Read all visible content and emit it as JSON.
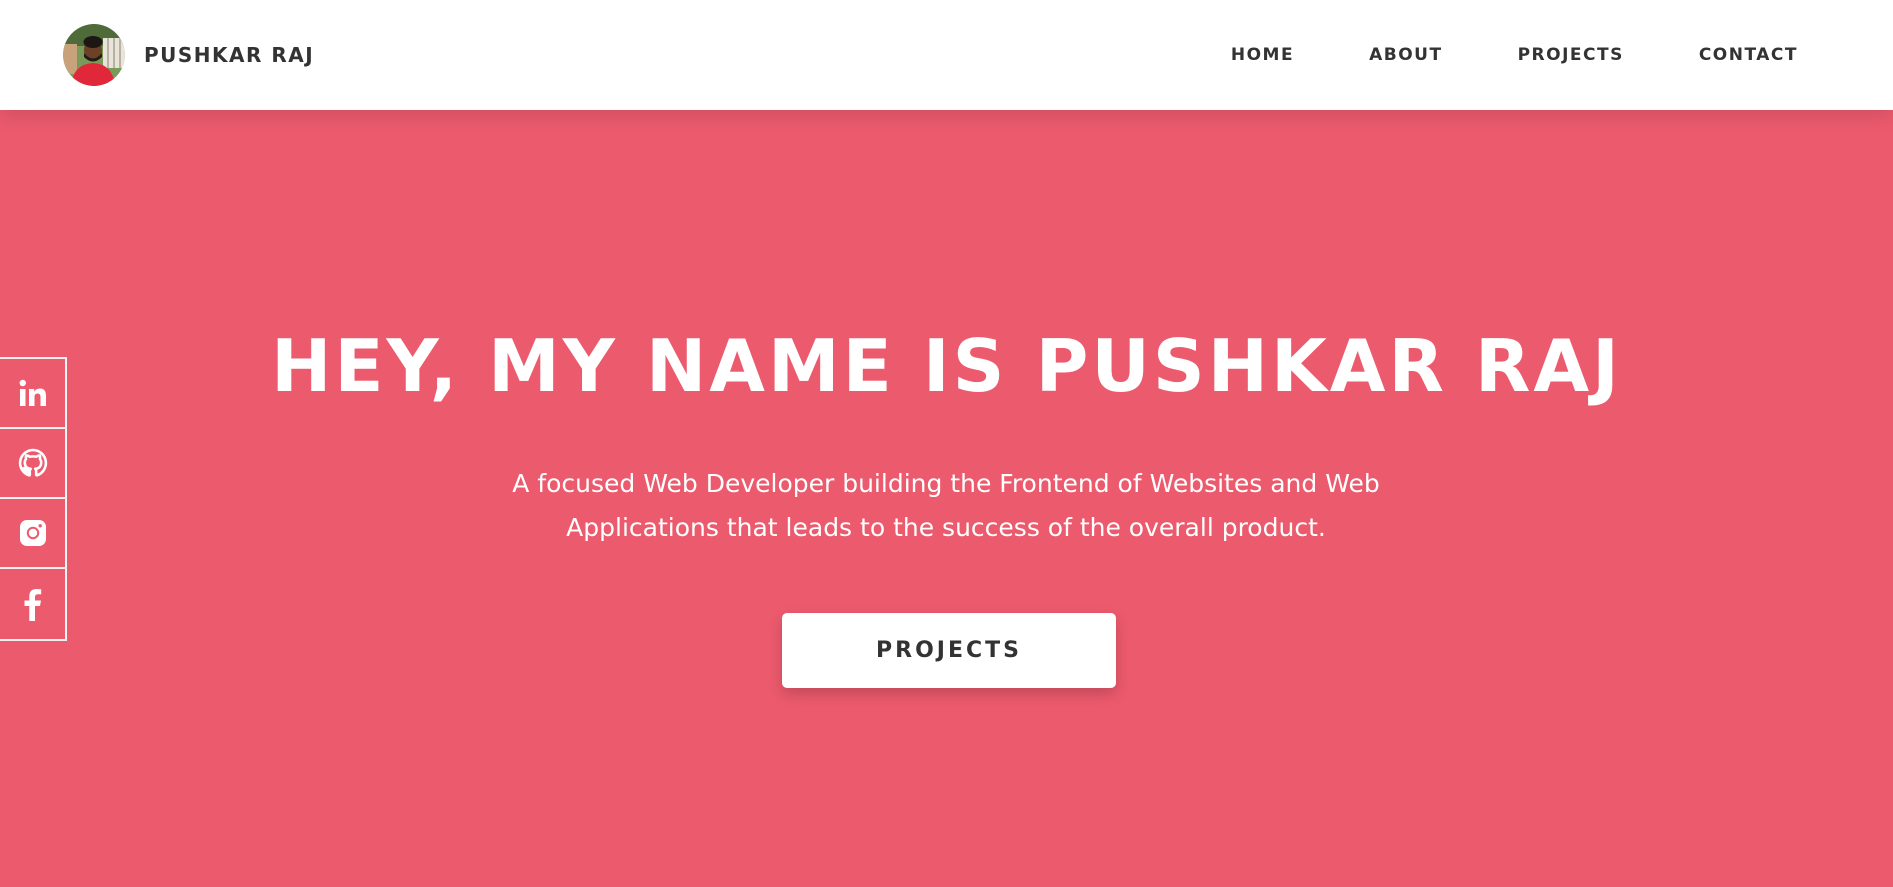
{
  "header": {
    "brand_name": "PUSHKAR RAJ",
    "nav": [
      {
        "label": "HOME"
      },
      {
        "label": "ABOUT"
      },
      {
        "label": "PROJECTS"
      },
      {
        "label": "CONTACT"
      }
    ]
  },
  "hero": {
    "title": "HEY, MY NAME IS PUSHKAR RAJ",
    "description": "A focused Web Developer building the Frontend of Websites and Web Applications that leads to the success of the overall product.",
    "button_label": "PROJECTS"
  },
  "social": [
    {
      "icon": "linkedin-icon"
    },
    {
      "icon": "github-icon"
    },
    {
      "icon": "instagram-icon"
    },
    {
      "icon": "facebook-icon"
    }
  ],
  "colors": {
    "accent": "#ec5a6d",
    "text_dark": "#333333",
    "white": "#ffffff"
  }
}
